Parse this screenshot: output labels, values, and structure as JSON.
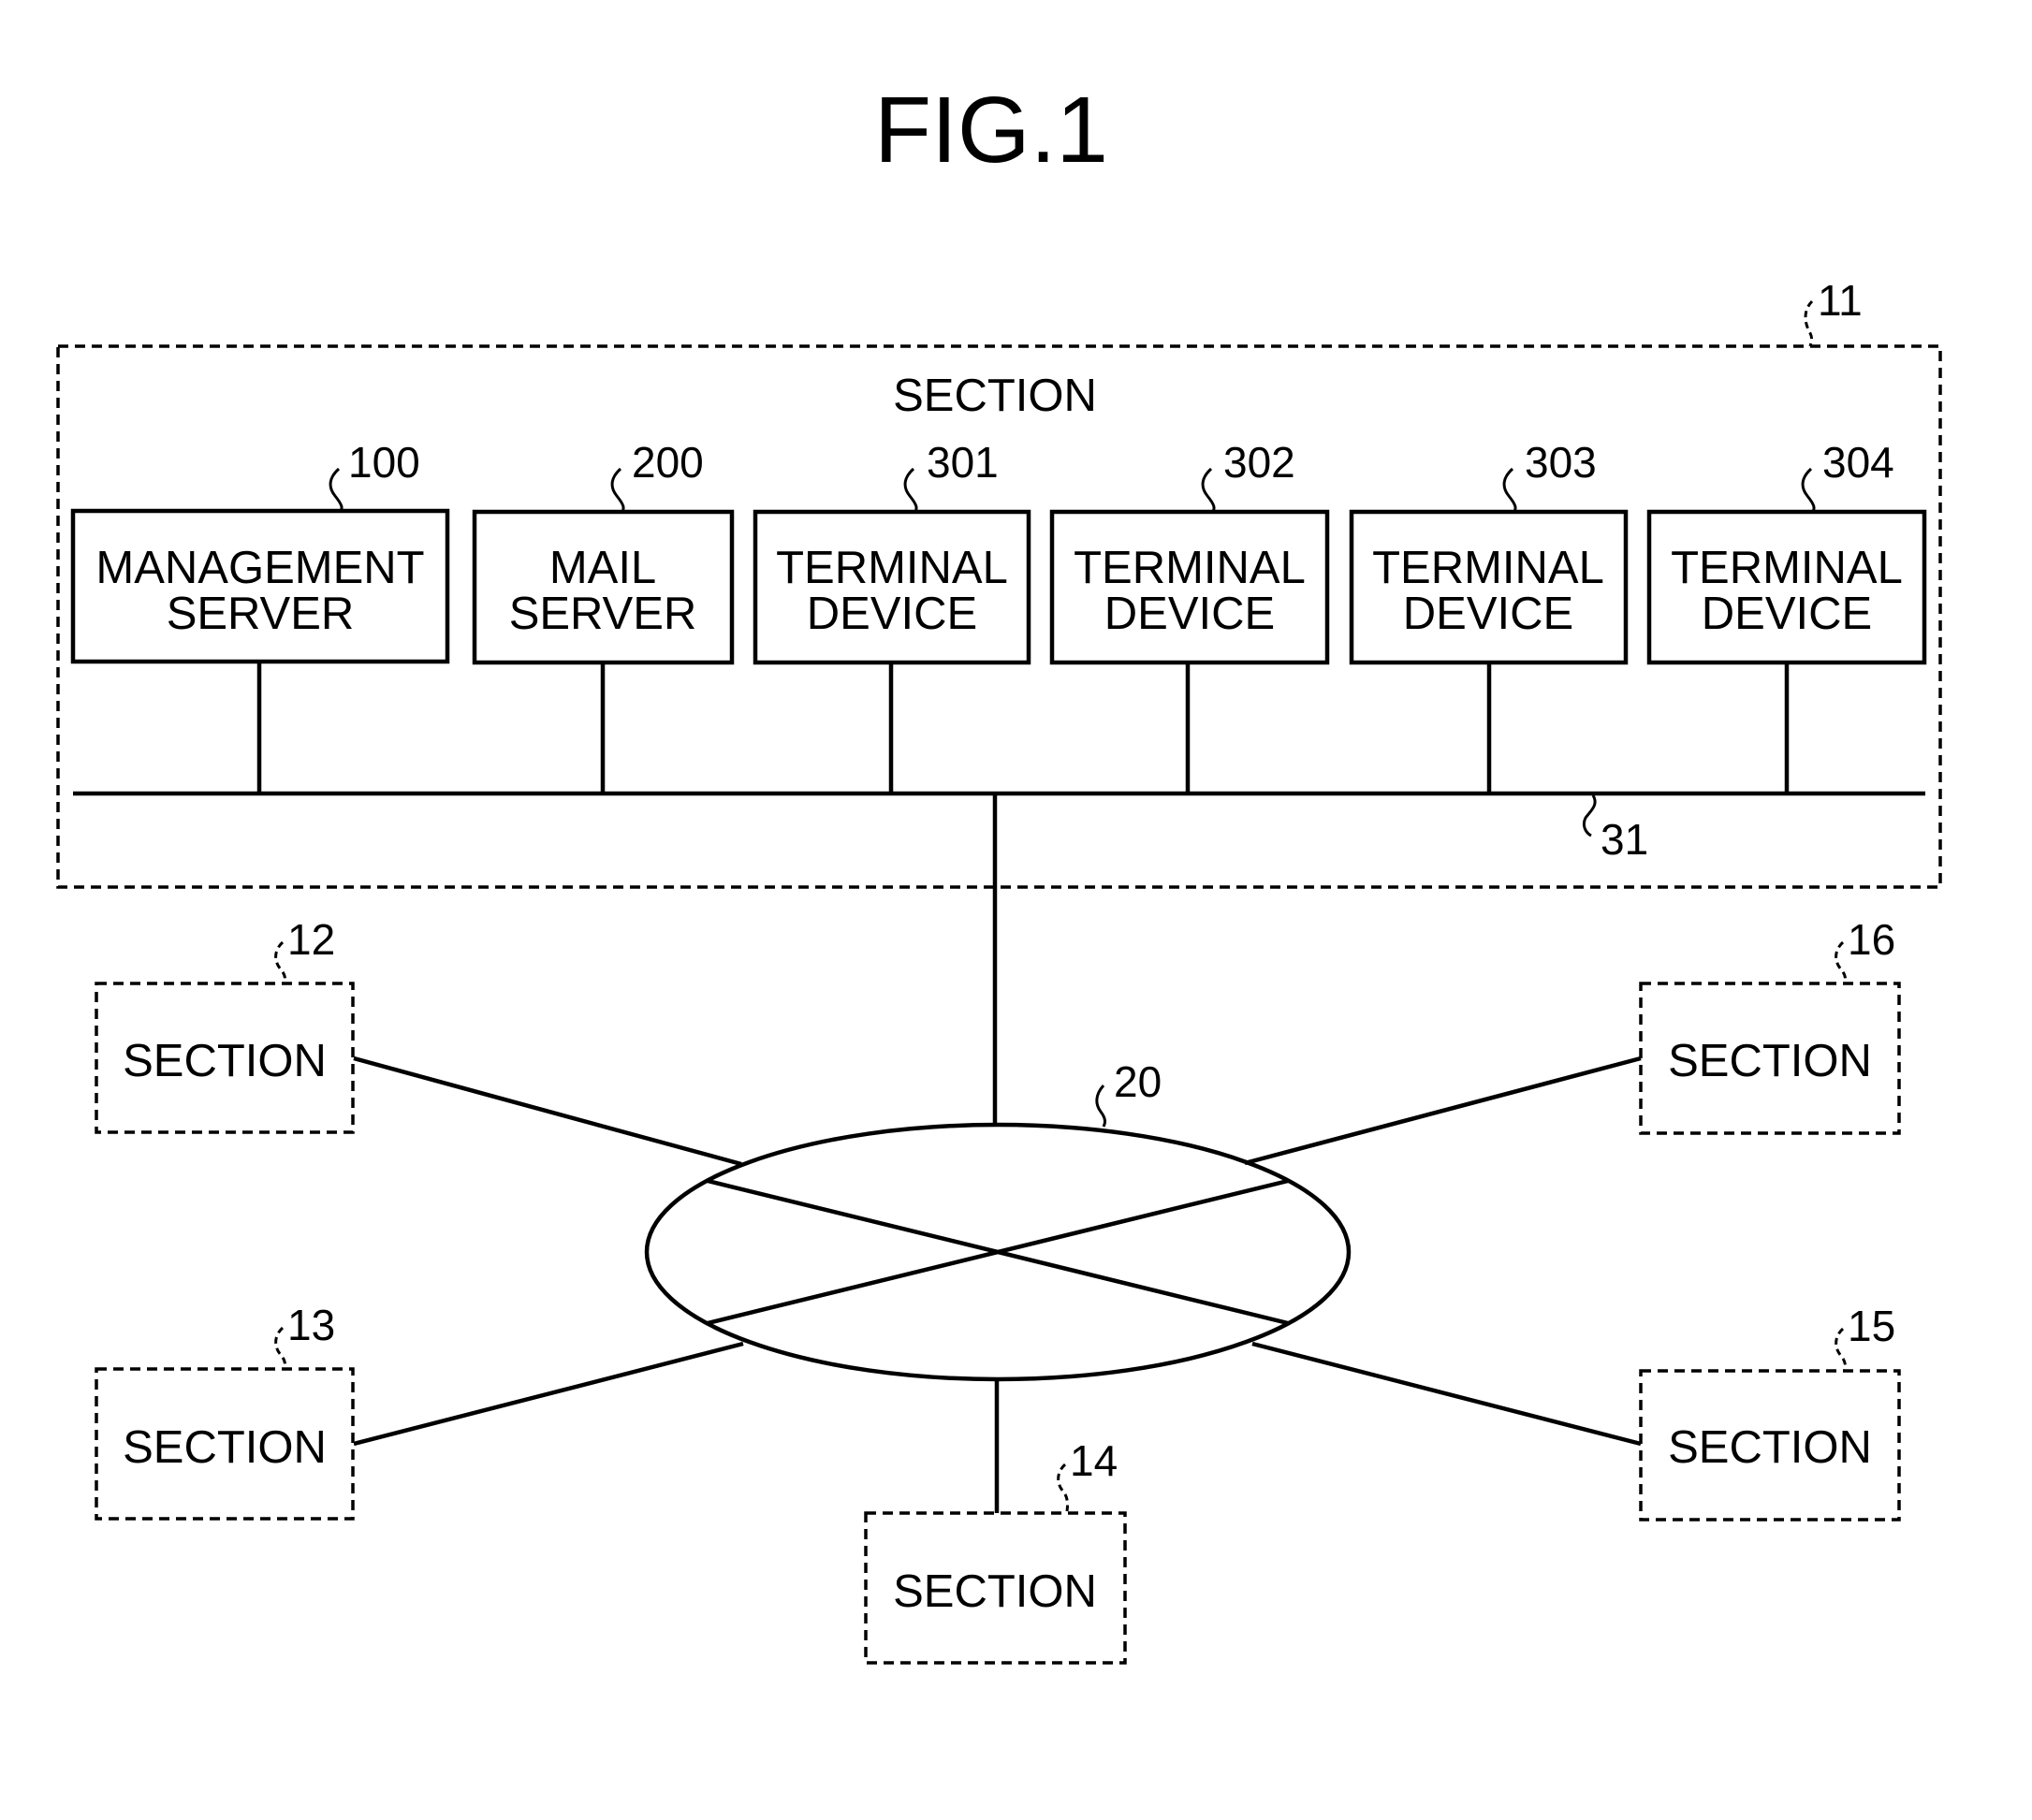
{
  "figure": {
    "title": "FIG.1",
    "main_section": {
      "label": "SECTION",
      "ref": "11",
      "bus_ref": "31",
      "devices": [
        {
          "ref": "100",
          "lines": [
            "MANAGEMENT",
            "SERVER"
          ]
        },
        {
          "ref": "200",
          "lines": [
            "MAIL",
            "SERVER"
          ]
        },
        {
          "ref": "301",
          "lines": [
            "TERMINAL",
            "DEVICE"
          ]
        },
        {
          "ref": "302",
          "lines": [
            "TERMINAL",
            "DEVICE"
          ]
        },
        {
          "ref": "303",
          "lines": [
            "TERMINAL",
            "DEVICE"
          ]
        },
        {
          "ref": "304",
          "lines": [
            "TERMINAL",
            "DEVICE"
          ]
        }
      ]
    },
    "network": {
      "ref": "20"
    },
    "other_sections": [
      {
        "ref": "12",
        "label": "SECTION"
      },
      {
        "ref": "13",
        "label": "SECTION"
      },
      {
        "ref": "14",
        "label": "SECTION"
      },
      {
        "ref": "15",
        "label": "SECTION"
      },
      {
        "ref": "16",
        "label": "SECTION"
      }
    ]
  }
}
